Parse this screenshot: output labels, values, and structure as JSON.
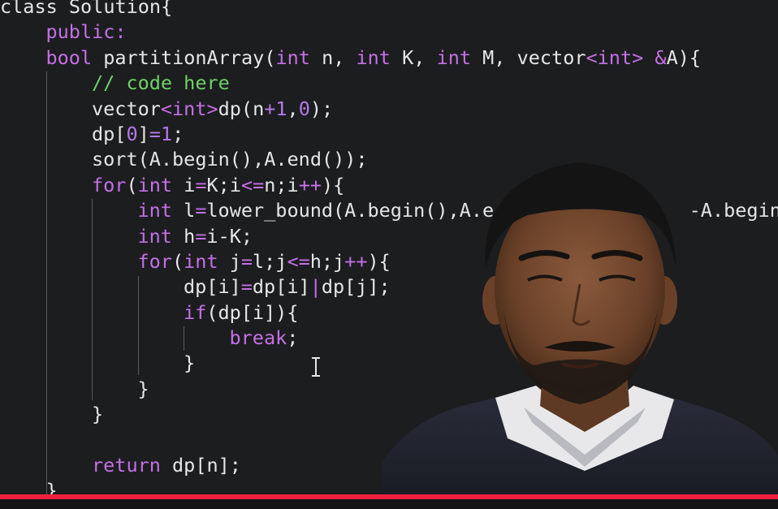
{
  "video": {
    "progress_percent": 100,
    "accent_color": "#f0213f"
  },
  "code_lines": [
    {
      "segments": [
        {
          "t": "class Solution{",
          "c": ""
        }
      ],
      "indent": 0
    },
    {
      "segments": [
        {
          "t": "public:",
          "c": "kw"
        }
      ],
      "indent": 1
    },
    {
      "segments": [
        {
          "t": "bool",
          "c": "ty"
        },
        {
          "t": " partitionArray(",
          "c": ""
        },
        {
          "t": "int",
          "c": "ty"
        },
        {
          "t": " n, ",
          "c": ""
        },
        {
          "t": "int",
          "c": "ty"
        },
        {
          "t": " K, ",
          "c": ""
        },
        {
          "t": "int",
          "c": "ty"
        },
        {
          "t": " M, vector",
          "c": ""
        },
        {
          "t": "<int>",
          "c": "ty"
        },
        {
          "t": " ",
          "c": ""
        },
        {
          "t": "&",
          "c": "op"
        },
        {
          "t": "A){",
          "c": ""
        }
      ],
      "indent": 1
    },
    {
      "segments": [
        {
          "t": "// code here",
          "c": "cm"
        }
      ],
      "indent": 2
    },
    {
      "segments": [
        {
          "t": "vector",
          "c": ""
        },
        {
          "t": "<int>",
          "c": "ty"
        },
        {
          "t": "dp(n",
          "c": ""
        },
        {
          "t": "+1",
          "c": "num"
        },
        {
          "t": ",",
          "c": ""
        },
        {
          "t": "0",
          "c": "num"
        },
        {
          "t": ");",
          "c": ""
        }
      ],
      "indent": 2
    },
    {
      "segments": [
        {
          "t": "dp[",
          "c": ""
        },
        {
          "t": "0",
          "c": "num"
        },
        {
          "t": "]",
          "c": ""
        },
        {
          "t": "=1",
          "c": "num"
        },
        {
          "t": ";",
          "c": ""
        }
      ],
      "indent": 2
    },
    {
      "segments": [
        {
          "t": "sort(A.begin(),A.end());",
          "c": ""
        }
      ],
      "indent": 2
    },
    {
      "segments": [
        {
          "t": "for",
          "c": "kw"
        },
        {
          "t": "(",
          "c": ""
        },
        {
          "t": "int",
          "c": "ty"
        },
        {
          "t": " i",
          "c": ""
        },
        {
          "t": "=",
          "c": "op"
        },
        {
          "t": "K;i",
          "c": ""
        },
        {
          "t": "<=",
          "c": "op"
        },
        {
          "t": "n;i",
          "c": ""
        },
        {
          "t": "++",
          "c": "op"
        },
        {
          "t": "){",
          "c": ""
        }
      ],
      "indent": 2
    },
    {
      "segments": [
        {
          "t": "int",
          "c": "ty"
        },
        {
          "t": " l",
          "c": ""
        },
        {
          "t": "=",
          "c": "op"
        },
        {
          "t": "lower_bound(A.begin(),A.e",
          "c": ""
        },
        {
          "t": "                 ",
          "c": ""
        },
        {
          "t": "-A.begin();",
          "c": ""
        }
      ],
      "indent": 3
    },
    {
      "segments": [
        {
          "t": "int",
          "c": "ty"
        },
        {
          "t": " h",
          "c": ""
        },
        {
          "t": "=",
          "c": "op"
        },
        {
          "t": "i-K;",
          "c": ""
        }
      ],
      "indent": 3
    },
    {
      "segments": [
        {
          "t": "for",
          "c": "kw"
        },
        {
          "t": "(",
          "c": ""
        },
        {
          "t": "int",
          "c": "ty"
        },
        {
          "t": " j",
          "c": ""
        },
        {
          "t": "=",
          "c": "op"
        },
        {
          "t": "l;j",
          "c": ""
        },
        {
          "t": "<=",
          "c": "op"
        },
        {
          "t": "h;j",
          "c": ""
        },
        {
          "t": "++",
          "c": "op"
        },
        {
          "t": "){",
          "c": ""
        }
      ],
      "indent": 3
    },
    {
      "segments": [
        {
          "t": "dp[i]",
          "c": ""
        },
        {
          "t": "=",
          "c": "op"
        },
        {
          "t": "dp[i]",
          "c": ""
        },
        {
          "t": "|",
          "c": "op"
        },
        {
          "t": "dp[j];",
          "c": ""
        }
      ],
      "indent": 4
    },
    {
      "segments": [
        {
          "t": "if",
          "c": "kw"
        },
        {
          "t": "(dp[i]){",
          "c": ""
        }
      ],
      "indent": 4
    },
    {
      "segments": [
        {
          "t": "break",
          "c": "kw"
        },
        {
          "t": ";",
          "c": ""
        }
      ],
      "indent": 5
    },
    {
      "segments": [
        {
          "t": "}",
          "c": ""
        }
      ],
      "indent": 4
    },
    {
      "segments": [
        {
          "t": "}",
          "c": ""
        }
      ],
      "indent": 3
    },
    {
      "segments": [
        {
          "t": "}",
          "c": ""
        }
      ],
      "indent": 2
    },
    {
      "segments": [
        {
          "t": "",
          "c": ""
        }
      ],
      "indent": 2
    },
    {
      "segments": [
        {
          "t": "return",
          "c": "kw"
        },
        {
          "t": " dp[n];",
          "c": ""
        }
      ],
      "indent": 2
    },
    {
      "segments": [
        {
          "t": "}",
          "c": ""
        }
      ],
      "indent": 1
    }
  ]
}
